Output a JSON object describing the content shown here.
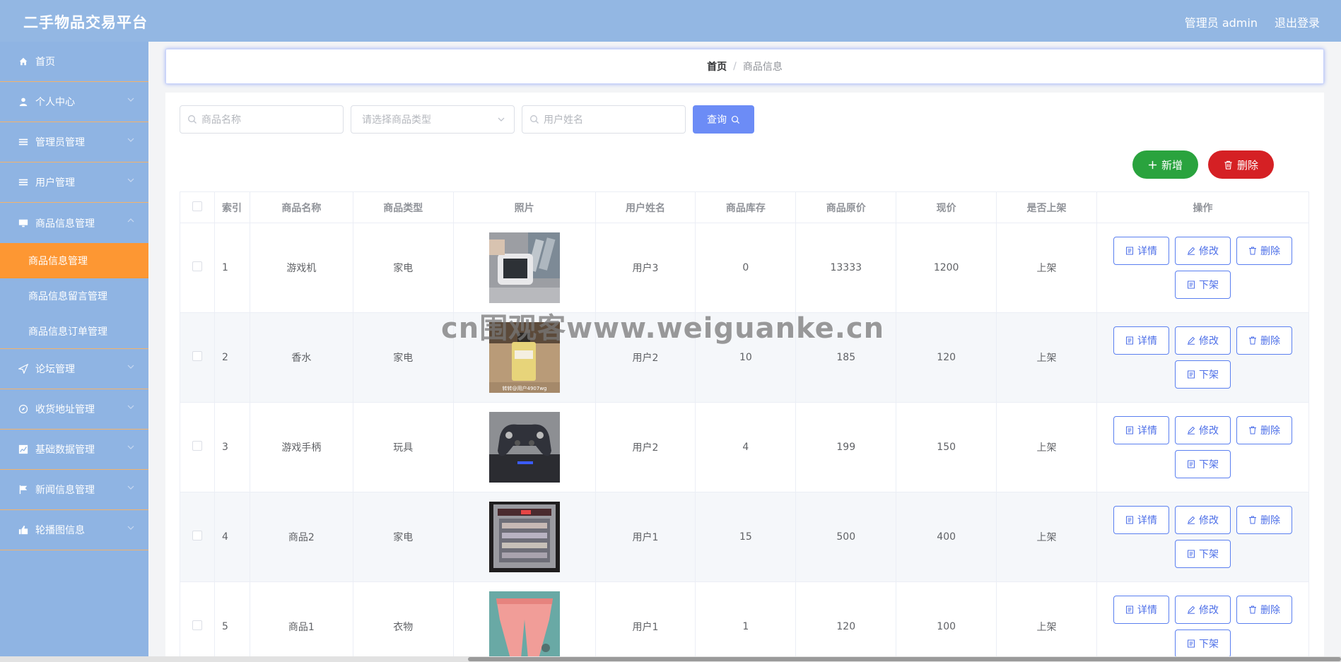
{
  "header": {
    "title": "二手物品交易平台",
    "user_label": "管理员 admin",
    "logout_label": "退出登录"
  },
  "sidebar": {
    "items": [
      {
        "label": "首页",
        "icon": "home-icon"
      },
      {
        "label": "个人中心",
        "icon": "user-icon"
      },
      {
        "label": "管理员管理",
        "icon": "list-icon"
      },
      {
        "label": "用户管理",
        "icon": "list-icon"
      },
      {
        "label": "商品信息管理",
        "icon": "monitor-icon"
      },
      {
        "label": "论坛管理",
        "icon": "send-icon"
      },
      {
        "label": "收货地址管理",
        "icon": "compass-icon"
      },
      {
        "label": "基础数据管理",
        "icon": "chart-icon"
      },
      {
        "label": "新闻信息管理",
        "icon": "flag-icon"
      },
      {
        "label": "轮播图信息",
        "icon": "thumb-icon"
      }
    ],
    "sub_items": [
      {
        "label": "商品信息管理",
        "active": true
      },
      {
        "label": "商品信息留言管理",
        "active": false
      },
      {
        "label": "商品信息订单管理",
        "active": false
      }
    ]
  },
  "breadcrumb": {
    "home": "首页",
    "separator": "/",
    "current": "商品信息"
  },
  "search": {
    "name_placeholder": "商品名称",
    "type_placeholder": "请选择商品类型",
    "user_placeholder": "用户姓名",
    "query_label": "查询"
  },
  "actions": {
    "add_label": "新增",
    "delete_label": "删除"
  },
  "table": {
    "headers": [
      "索引",
      "商品名称",
      "商品类型",
      "照片",
      "用户姓名",
      "商品库存",
      "商品原价",
      "现价",
      "是否上架",
      "操作"
    ],
    "rows": [
      {
        "index": "1",
        "name": "游戏机",
        "type": "家电",
        "photo_caption": "",
        "user": "用户3",
        "stock": "0",
        "original_price": "13333",
        "price": "1200",
        "status": "上架"
      },
      {
        "index": "2",
        "name": "香水",
        "type": "家电",
        "photo_caption": "转转@用户4907wg",
        "user": "用户2",
        "stock": "10",
        "original_price": "185",
        "price": "120",
        "status": "上架"
      },
      {
        "index": "3",
        "name": "游戏手柄",
        "type": "玩具",
        "photo_caption": "",
        "user": "用户2",
        "stock": "4",
        "original_price": "199",
        "price": "150",
        "status": "上架"
      },
      {
        "index": "4",
        "name": "商品2",
        "type": "家电",
        "photo_caption": "",
        "user": "用户1",
        "stock": "15",
        "original_price": "500",
        "price": "400",
        "status": "上架"
      },
      {
        "index": "5",
        "name": "商品1",
        "type": "衣物",
        "photo_caption": "",
        "user": "用户1",
        "stock": "1",
        "original_price": "120",
        "price": "100",
        "status": "上架"
      }
    ],
    "op_labels": {
      "detail": "详情",
      "edit": "修改",
      "delete": "删除",
      "offshelf": "下架"
    }
  },
  "watermark": "cn围观客www.weiguanke.cn",
  "colors": {
    "header_bg": "#93b7e3",
    "sidebar_bg": "#8fb4e3",
    "active_item": "#fd9733",
    "primary": "#6c8cf6",
    "success": "#2aa33e",
    "danger": "#d52024"
  }
}
